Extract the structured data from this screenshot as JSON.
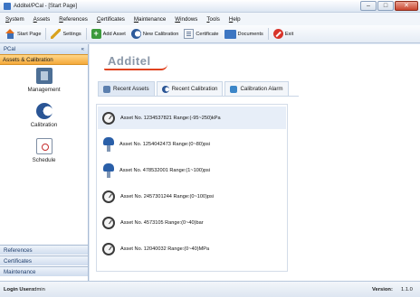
{
  "window": {
    "title": "Additel/PCal - [Start Page]",
    "controls": {
      "minimize": "–",
      "maximize": "□",
      "close": "✕"
    }
  },
  "menu": [
    "System",
    "Assets",
    "References",
    "Certificates",
    "Maintenance",
    "Windows",
    "Tools",
    "Help"
  ],
  "toolbar": {
    "start_page": "Start Page",
    "settings": "Settings",
    "add_asset": "Add Asset",
    "new_calibration": "New Calibration",
    "certificate": "Certificate",
    "documents": "Documents",
    "exit": "Exit"
  },
  "sidebar": {
    "header": "PCal",
    "collapse": "«",
    "active_group": "Assets & Calibration",
    "items": [
      "Management",
      "Calibration",
      "Schedule"
    ],
    "bottom_groups": [
      "References",
      "Certificates",
      "Maintenance"
    ]
  },
  "brand": {
    "name": "Additel"
  },
  "tabs": [
    "Recent Assets",
    "Recent Calibration",
    "Calibration Alarm"
  ],
  "assets": [
    {
      "text": "Asset No. 1234537821  Range:(-95~250)kPa",
      "icon": "gauge-icon"
    },
    {
      "text": "Asset No. 1254042473  Range:(0~80)psi",
      "icon": "transmitter-icon"
    },
    {
      "text": "Asset No. 478532001  Range:(1~100)psi",
      "icon": "transmitter-icon"
    },
    {
      "text": "Asset No. 2457301244  Range:(0~100)psi",
      "icon": "gauge-icon"
    },
    {
      "text": "Asset No. 4573105  Range:(0~40)bar",
      "icon": "gauge-icon"
    },
    {
      "text": "Asset No. 12040032  Range:(0~40)MPa",
      "icon": "gauge-icon"
    }
  ],
  "status": {
    "login_label": "Login User :",
    "login_user": "admin",
    "version_label": "Version:",
    "version": "1.1.0"
  },
  "colors": {
    "accent": "#f4a93a",
    "brand_red": "#e0421f",
    "chrome": "#dfe8f4"
  }
}
